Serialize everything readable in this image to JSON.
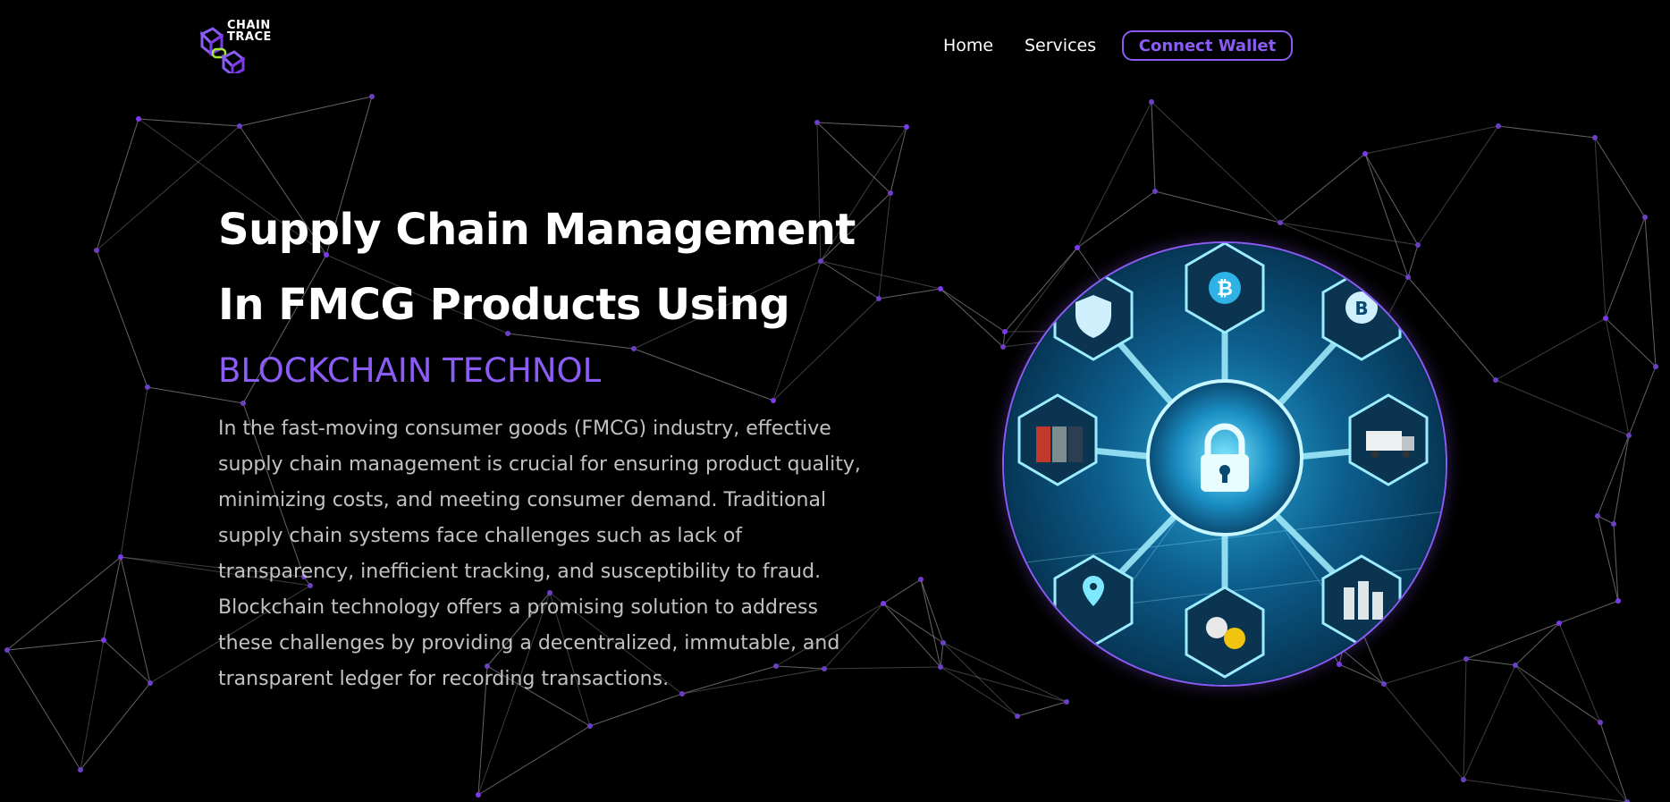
{
  "brand": {
    "line1": "CHAIN",
    "line2": "TRACE"
  },
  "nav": {
    "home": "Home",
    "services": "Services",
    "connect_wallet": "Connect Wallet"
  },
  "hero": {
    "title_line1": "Supply Chain Management",
    "title_line2": "In FMCG Products Using",
    "highlight": "BLOCKCHAIN TECHNOL",
    "description": "In the fast-moving consumer goods (FMCG) industry, effective supply chain management is crucial for ensuring product quality, minimizing costs, and meeting consumer demand. Traditional supply chain systems face challenges such as lack of transparency, inefficient tracking, and susceptibility to fraud. Blockchain technology offers a promising solution to address these challenges by providing a decentralized, immutable, and transparent ledger for recording transactions."
  },
  "colors": {
    "background": "#000000",
    "accent": "#8b5cf6",
    "text": "#ffffff",
    "muted_text": "#c2c2c2",
    "logo_green": "#a3e635"
  },
  "icons": [
    "chain-logo-icon",
    "shield-lock-icon",
    "bitcoin-icon",
    "truck-icon",
    "cargo-containers-icon",
    "coin-stack-icon",
    "location-pin-icon",
    "cube-node-icon"
  ]
}
